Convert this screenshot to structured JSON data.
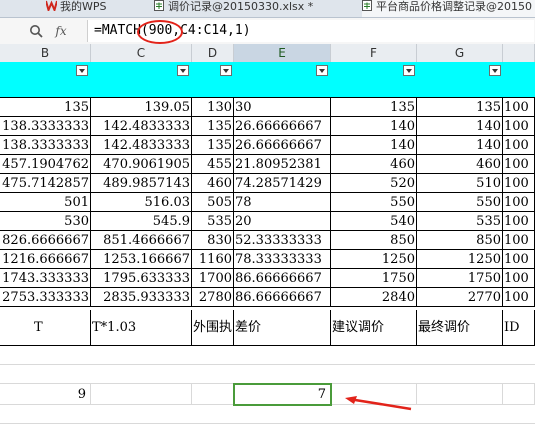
{
  "tabs": [
    {
      "label": "我的WPS",
      "icon": "wps-logo-icon"
    },
    {
      "label": "调价记录@20150330.xlsx *",
      "icon": "spreadsheet-icon"
    },
    {
      "label": "平台商品价格调整记录@20150",
      "icon": "spreadsheet-icon"
    }
  ],
  "formula_bar": {
    "zoom_icon": "magnifier-icon",
    "fx_label": "fx",
    "formula": "=MATCH(900,C4:C14,1)"
  },
  "columns": [
    "B",
    "C",
    "D",
    "E",
    "F",
    "G",
    ""
  ],
  "selected_column": "E",
  "rows": [
    [
      "135",
      "139.05",
      "130",
      "30",
      "135",
      "135",
      "100"
    ],
    [
      "138.3333333",
      "142.4833333",
      "135",
      "26.66666667",
      "140",
      "140",
      "100"
    ],
    [
      "138.3333333",
      "142.4833333",
      "135",
      "26.66666667",
      "140",
      "140",
      "100"
    ],
    [
      "457.1904762",
      "470.9061905",
      "455",
      "21.80952381",
      "460",
      "460",
      "100"
    ],
    [
      "475.7142857",
      "489.9857143",
      "460",
      "74.28571429",
      "520",
      "510",
      "100"
    ],
    [
      "501",
      "516.03",
      "505",
      "78",
      "550",
      "550",
      "100"
    ],
    [
      "530",
      "545.9",
      "535",
      "20",
      "540",
      "535",
      "100"
    ],
    [
      "826.6666667",
      "851.4666667",
      "830",
      "52.33333333",
      "850",
      "850",
      "100"
    ],
    [
      "1216.666667",
      "1253.166667",
      "1160",
      "78.33333333",
      "1250",
      "1250",
      "100"
    ],
    [
      "1743.333333",
      "1795.633333",
      "1700",
      "86.66666667",
      "1750",
      "1750",
      "100"
    ],
    [
      "2753.333333",
      "2835.933333",
      "2780",
      "86.66666667",
      "2840",
      "2770",
      "100"
    ]
  ],
  "header_row": [
    "T",
    "T*1.03",
    "外围执",
    "差价",
    "建议调价",
    "最终调价",
    "ID"
  ],
  "result_row": {
    "b_value": "9",
    "e_value": "7"
  },
  "colors": {
    "accent_cyan": "#00ffff",
    "selection_green": "#4a9b3a",
    "annotation_red": "#e2231a"
  }
}
